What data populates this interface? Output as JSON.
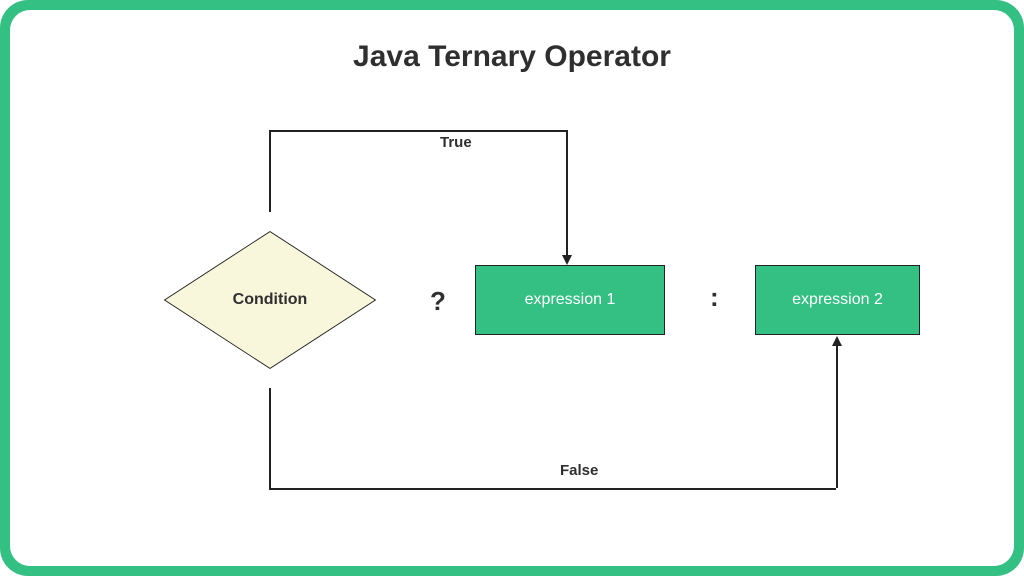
{
  "title": "Java Ternary Operator",
  "condition": {
    "label": "Condition"
  },
  "question_mark": "?",
  "colon": ":",
  "expression1": {
    "label": "expression 1"
  },
  "expression2": {
    "label": "expression 2"
  },
  "edges": {
    "true_label": "True",
    "false_label": "False"
  },
  "colors": {
    "accent": "#34c082",
    "diamond_fill": "#f8f7dc",
    "text": "#2f2f2f"
  }
}
